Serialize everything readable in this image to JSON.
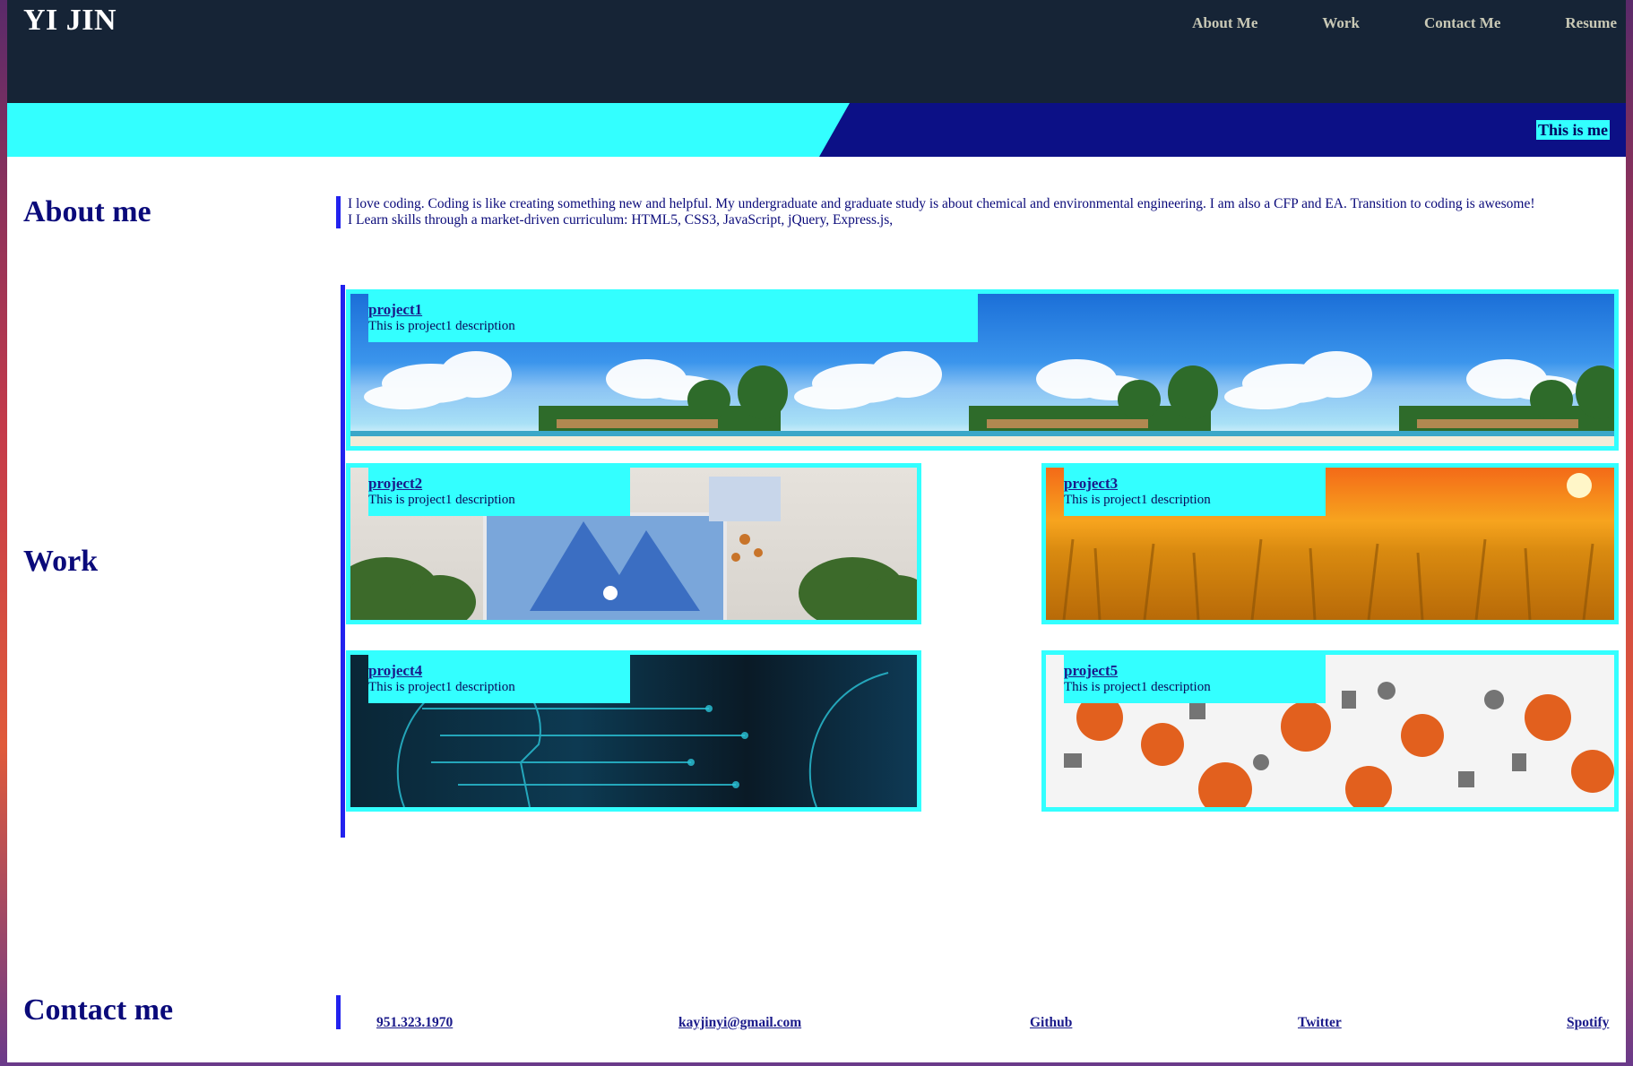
{
  "brand": "YI JIN",
  "nav": [
    "About Me",
    "Work",
    "Contact Me",
    "Resume"
  ],
  "banner": {
    "text": "This is me"
  },
  "about": {
    "title": "About me",
    "line1": "I love coding. Coding is like creating something new and helpful. My undergraduate and graduate study is about chemical and environmental engineering. I am also a CFP and EA. Transition to coding is awesome!",
    "line2": "I Learn skills through a market-driven curriculum: HTML5, CSS3, JavaScript, jQuery, Express.js,"
  },
  "work": {
    "title": "Work",
    "projects": [
      {
        "name": "project1",
        "desc": "This is project1 description",
        "image": "beach-image"
      },
      {
        "name": "project2",
        "desc": "This is project1 description",
        "image": "iceberg-painting-image"
      },
      {
        "name": "project3",
        "desc": "This is project1 description",
        "image": "wheat-field-image"
      },
      {
        "name": "project4",
        "desc": "This is project1 description",
        "image": "circuit-head-image"
      },
      {
        "name": "project5",
        "desc": "This is project1 description",
        "image": "science-icons-image"
      }
    ]
  },
  "contact": {
    "title": "Contact me",
    "links": [
      "951.323.1970",
      "kayjinyi@gmail.com",
      "Github",
      "Twitter",
      "Spotify"
    ]
  },
  "colors": {
    "header": "#162436",
    "accent": "#33ffff",
    "navy": "#0a0a7a",
    "banner_dark": "#0c1086",
    "bar": "#2222ee"
  }
}
